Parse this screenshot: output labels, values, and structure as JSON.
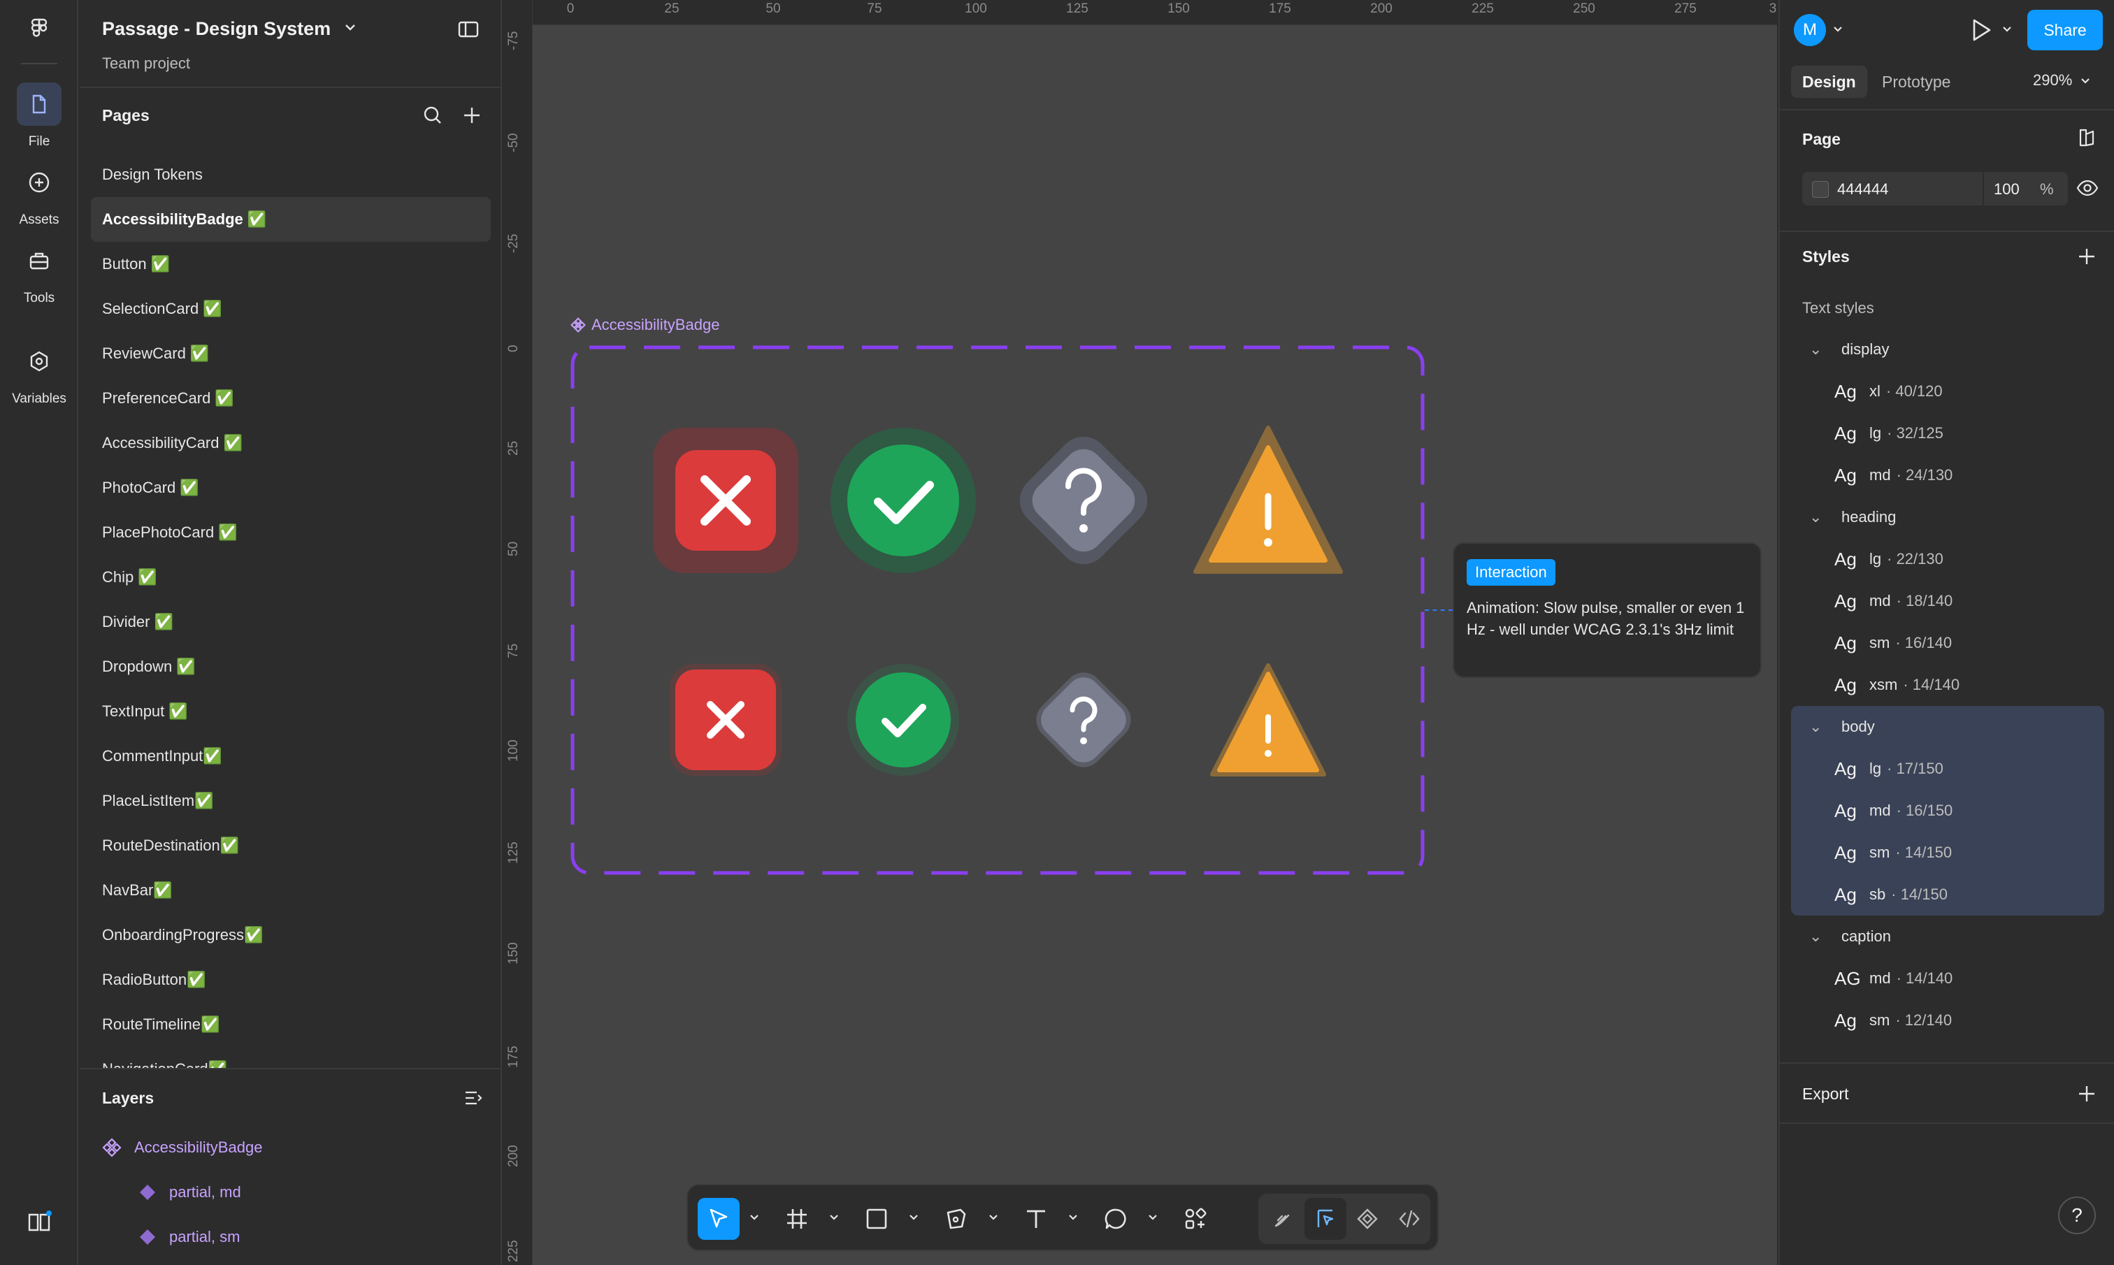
{
  "rail": {
    "items": [
      {
        "label": "File",
        "icon": "file-icon"
      },
      {
        "label": "Assets",
        "icon": "assets-icon"
      },
      {
        "label": "Tools",
        "icon": "tools-icon"
      },
      {
        "label": "Variables",
        "icon": "variables-icon"
      }
    ]
  },
  "project": {
    "title": "Passage - Design System",
    "subtitle": "Team project"
  },
  "pages": {
    "title": "Pages",
    "items": [
      "Design Tokens",
      "AccessibilityBadge ✅",
      "Button ✅",
      "SelectionCard ✅",
      "ReviewCard ✅",
      "PreferenceCard ✅",
      "AccessibilityCard ✅",
      "PhotoCard ✅",
      "PlacePhotoCard ✅",
      "Chip ✅",
      "Divider ✅",
      "Dropdown ✅",
      "TextInput ✅",
      "CommentInput✅",
      "PlaceListItem✅",
      "RouteDestination✅",
      "NavBar✅",
      "OnboardingProgress✅",
      "RadioButton✅",
      "RouteTimeline✅",
      "NavigationCard✅"
    ],
    "selected_index": 1
  },
  "layers": {
    "title": "Layers",
    "items": [
      {
        "label": "AccessibilityBadge",
        "icon": "component-icon"
      },
      {
        "label": "partial, md",
        "icon": "variant-icon"
      },
      {
        "label": "partial, sm",
        "icon": "variant-icon"
      }
    ]
  },
  "canvas": {
    "background": "#444444",
    "ruler_top": [
      "0",
      "25",
      "50",
      "75",
      "100",
      "125",
      "150",
      "175",
      "200",
      "225",
      "250",
      "275",
      "3"
    ],
    "ruler_left": [
      "-75",
      "-50",
      "-25",
      "0",
      "25",
      "50",
      "75",
      "100",
      "125",
      "150",
      "175",
      "200",
      "225"
    ],
    "frame_label": "AccessibilityBadge",
    "tooltip": {
      "tag": "Interaction",
      "text": "Animation: Slow pulse, smaller or even 1 Hz - well under WCAG 2.3.1's 3Hz limit"
    },
    "badge_colors": {
      "error": "#dc3b3b",
      "success": "#1ea55a",
      "unknown": "#7a7e8f",
      "warning": "#f0a030"
    },
    "frame_stroke": "#8a3ff0"
  },
  "toolbar": {
    "tools": [
      "move-icon",
      "frame-icon",
      "rectangle-icon",
      "pen-icon",
      "text-icon",
      "comment-icon",
      "actions-icon"
    ],
    "modes": [
      "draw-icon",
      "design-icon",
      "component-icon",
      "code-icon"
    ]
  },
  "right": {
    "avatar_initial": "M",
    "share_label": "Share",
    "tabs": [
      "Design",
      "Prototype"
    ],
    "zoom": "290%",
    "page_title": "Page",
    "page_color": "444444",
    "page_opacity": "100",
    "page_pct": "%",
    "styles_title": "Styles",
    "text_styles_label": "Text styles",
    "groups": [
      {
        "name": "display",
        "styles": [
          {
            "ag": "Ag",
            "name": "xl",
            "spec": "· 40/120"
          },
          {
            "ag": "Ag",
            "name": "lg",
            "spec": "· 32/125"
          },
          {
            "ag": "Ag",
            "name": "md",
            "spec": "· 24/130"
          }
        ]
      },
      {
        "name": "heading",
        "styles": [
          {
            "ag": "Ag",
            "name": "lg",
            "spec": "· 22/130"
          },
          {
            "ag": "Ag",
            "name": "md",
            "spec": "· 18/140"
          },
          {
            "ag": "Ag",
            "name": "sm",
            "spec": "· 16/140"
          },
          {
            "ag": "Ag",
            "name": "xsm",
            "spec": "· 14/140"
          }
        ]
      },
      {
        "name": "body",
        "styles": [
          {
            "ag": "Ag",
            "name": "lg",
            "spec": "· 17/150"
          },
          {
            "ag": "Ag",
            "name": "md",
            "spec": "· 16/150"
          },
          {
            "ag": "Ag",
            "name": "sm",
            "spec": "· 14/150"
          },
          {
            "ag": "Ag",
            "name": "sb",
            "spec": "· 14/150"
          }
        ]
      },
      {
        "name": "caption",
        "styles": [
          {
            "ag": "AG",
            "name": "md",
            "spec": "· 14/140"
          },
          {
            "ag": "Ag",
            "name": "sm",
            "spec": "· 12/140"
          }
        ]
      }
    ],
    "export_title": "Export",
    "help": "?"
  }
}
